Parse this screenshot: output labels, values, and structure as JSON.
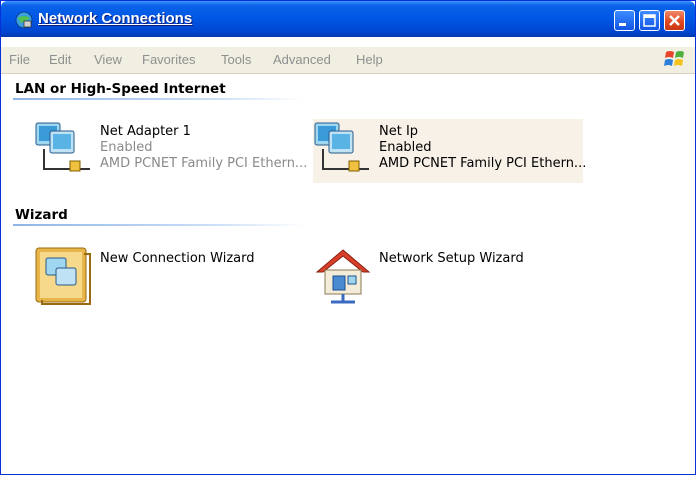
{
  "window": {
    "title": "Network Connections"
  },
  "menu": [
    "File",
    "Edit",
    "View",
    "Favorites",
    "Tools",
    "Advanced",
    "Help"
  ],
  "groups": {
    "lan": {
      "title": "LAN or High-Speed Internet",
      "items": [
        {
          "name": "Net Adapter 1",
          "status": "Enabled",
          "device": "AMD PCNET Family PCI Ethern..."
        },
        {
          "name": "Net Ip",
          "status": "Enabled",
          "device": "AMD PCNET Family PCI Ethern..."
        }
      ]
    },
    "wizard": {
      "title": "Wizard",
      "items": [
        {
          "name": "New Connection Wizard"
        },
        {
          "name": "Network Setup Wizard"
        }
      ]
    }
  },
  "colors": {
    "titlebar": "#0058e6",
    "close_button": "#e0491f",
    "menubar": "#f1efe2"
  }
}
